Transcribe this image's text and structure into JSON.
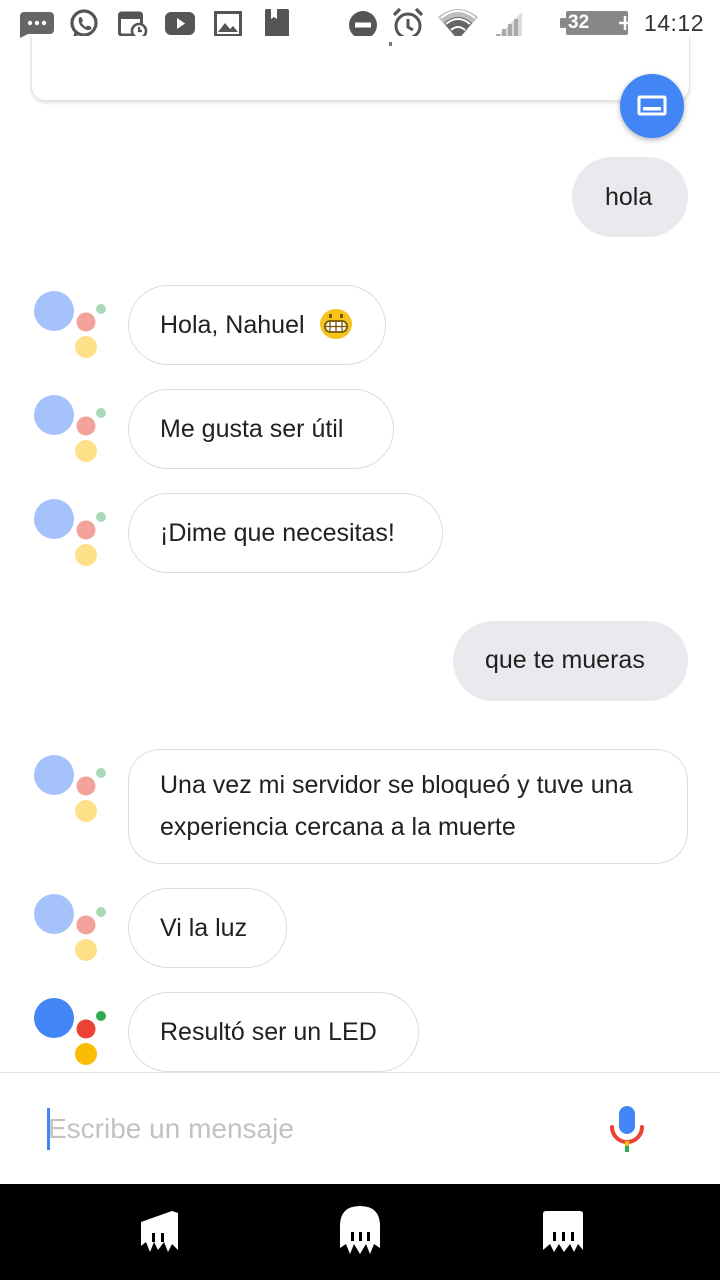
{
  "status_bar": {
    "time": "14:12",
    "battery": "32 %",
    "icons": [
      "messages-icon",
      "whatsapp-icon",
      "calendar-icon",
      "youtube-icon",
      "gallery-icon",
      "bookmark-icon",
      "do-not-disturb-icon",
      "alarm-icon",
      "wifi-icon",
      "signal-icon"
    ]
  },
  "conversation": {
    "messages": [
      {
        "from": "user",
        "text": "hola"
      },
      {
        "from": "assistant",
        "text": "Hola, Nahuel",
        "emoji": "grinning-face"
      },
      {
        "from": "assistant",
        "text": "Me gusta ser útil"
      },
      {
        "from": "assistant",
        "text": "¡Dime que necesitas!"
      },
      {
        "from": "user",
        "text": "que te mueras"
      },
      {
        "from": "assistant",
        "text": "Una vez mi servidor se bloqueó y tuve una experiencia cercana a la muerte"
      },
      {
        "from": "assistant",
        "text": "Vi la luz"
      },
      {
        "from": "assistant",
        "text": "Resultó ser un LED"
      }
    ]
  },
  "input": {
    "placeholder": "Escribe un mensaje",
    "value": ""
  },
  "colors": {
    "assistant_blue": "#4285f4",
    "assistant_red": "#ea4335",
    "assistant_yellow": "#fbbc04",
    "assistant_green": "#34a853",
    "user_bubble": "#e8eaed"
  }
}
